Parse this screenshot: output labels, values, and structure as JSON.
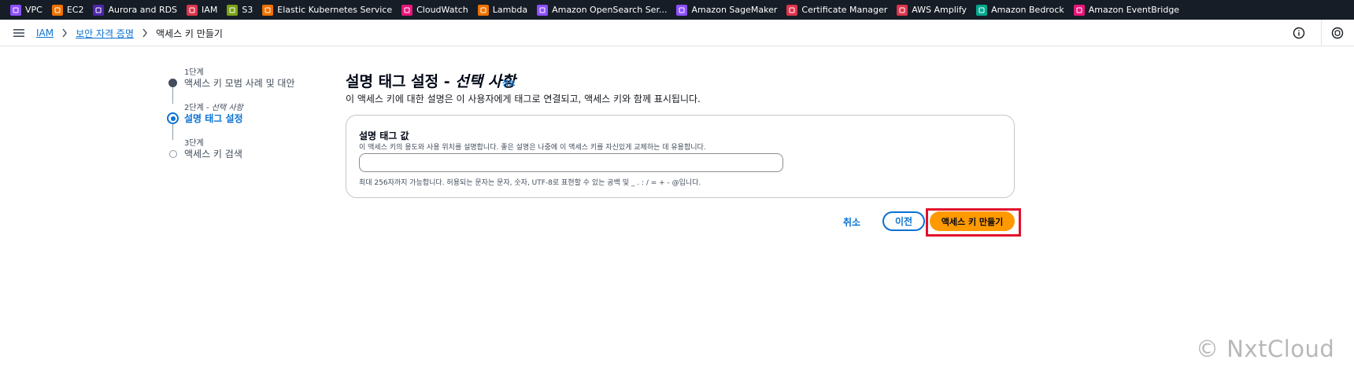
{
  "favorites": [
    {
      "label": "VPC",
      "icon": "vpc-icon",
      "color": "#8c4fff"
    },
    {
      "label": "EC2",
      "icon": "ec2-icon",
      "color": "#ed7100"
    },
    {
      "label": "Aurora and RDS",
      "icon": "rds-icon",
      "color": "#4d27aa"
    },
    {
      "label": "IAM",
      "icon": "iam-icon",
      "color": "#dd344c"
    },
    {
      "label": "S3",
      "icon": "s3-icon",
      "color": "#7aa116"
    },
    {
      "label": "Elastic Kubernetes Service",
      "icon": "eks-icon",
      "color": "#ed7100"
    },
    {
      "label": "CloudWatch",
      "icon": "cloudwatch-icon",
      "color": "#e7157b"
    },
    {
      "label": "Lambda",
      "icon": "lambda-icon",
      "color": "#ed7100"
    },
    {
      "label": "Amazon OpenSearch Ser...",
      "icon": "opensearch-icon",
      "color": "#8c4fff"
    },
    {
      "label": "Amazon SageMaker",
      "icon": "sagemaker-icon",
      "color": "#8c4fff"
    },
    {
      "label": "Certificate Manager",
      "icon": "certificate-icon",
      "color": "#dd344c"
    },
    {
      "label": "AWS Amplify",
      "icon": "amplify-icon",
      "color": "#dd344c"
    },
    {
      "label": "Amazon Bedrock",
      "icon": "bedrock-icon",
      "color": "#01a88d"
    },
    {
      "label": "Amazon EventBridge",
      "icon": "eventbridge-icon",
      "color": "#e7157b"
    }
  ],
  "breadcrumb": {
    "iam": "IAM",
    "credentials": "보안 자격 증명",
    "current": "액세스 키 만들기"
  },
  "steps": [
    {
      "num": "1단계",
      "title": "액세스 키 모범 사례 및 대안",
      "state": "done"
    },
    {
      "num": "2단계 - ",
      "num_optional": "선택 사항",
      "title": "설명 태그 설정",
      "state": "active"
    },
    {
      "num": "3단계",
      "title": "액세스 키 검색",
      "state": "pending"
    }
  ],
  "main": {
    "title": "설명 태그 설정 - ",
    "title_optional": "선택 사항",
    "info_link": "정보",
    "description": "이 액세스 키에 대한 설명은 이 사용자에게 태그로 연결되고, 액세스 키와 함께 표시됩니다."
  },
  "field": {
    "label": "설명 태그 값",
    "description": "이 액세스 키의 용도와 사용 위치를 설명합니다. 좋은 설명은 나중에 이 액세스 키를 자신있게 교체하는 데 유용합니다.",
    "value": "",
    "constraint": "최대 256자까지 가능합니다. 허용되는 문자는 문자, 숫자, UTF-8로 표현할 수 있는 공백 및 _ . : / = + - @입니다."
  },
  "actions": {
    "cancel": "취소",
    "previous": "이전",
    "create": "액세스 키 만들기"
  },
  "watermark": "© NxtCloud",
  "colors": {
    "accent": "#0972d3",
    "primary_button": "#ff9900",
    "highlight": "#e0112b",
    "topbar": "#161d26"
  }
}
